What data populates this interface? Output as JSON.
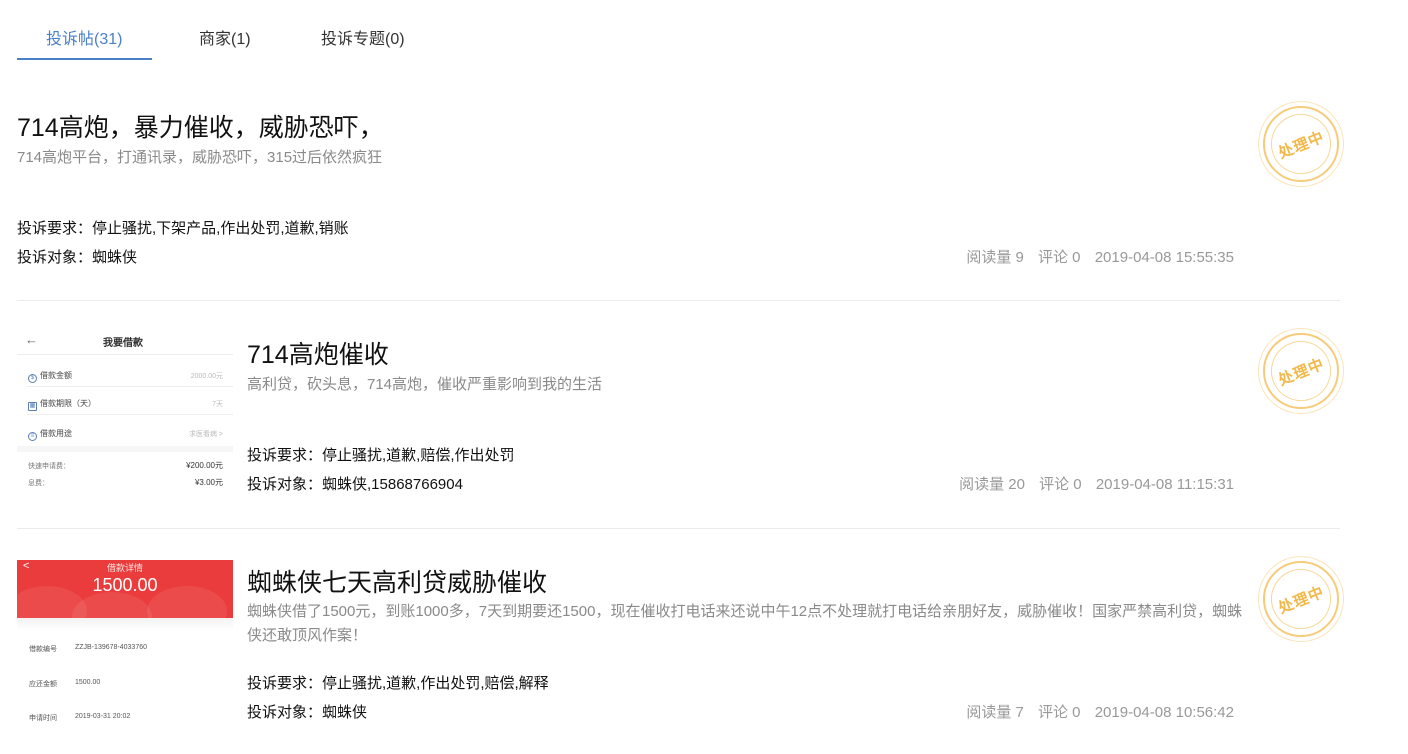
{
  "tabs": [
    {
      "label": "投诉帖(31)",
      "active": true
    },
    {
      "label": "商家(1)",
      "active": false
    },
    {
      "label": "投诉专题(0)",
      "active": false
    }
  ],
  "colors": {
    "accent": "#4a80c8",
    "stamp": "#f2b84a"
  },
  "posts": [
    {
      "title": "714高炮，暴力催收，威胁恐吓，",
      "summary": "714高炮平台，打通讯录，威胁恐吓，315过后依然疯狂",
      "requirement": "投诉要求：停止骚扰,下架产品,作出处罚,道歉,销账",
      "target": "投诉对象：蜘蛛侠",
      "reads": "阅读量 9",
      "comments": "评论 0",
      "time": "2019-04-08 15:55:35",
      "status": "处理中"
    },
    {
      "title": "714高炮催收",
      "summary": "高利贷，砍头息，714高炮，催收严重影响到我的生活",
      "requirement": "投诉要求：停止骚扰,道歉,赔偿,作出处罚",
      "target": "投诉对象：蜘蛛侠,15868766904",
      "reads": "阅读量 20",
      "comments": "评论 0",
      "time": "2019-04-08 11:15:31",
      "status": "处理中",
      "thumb": {
        "back": "←",
        "title": "我要借款",
        "rows": [
          {
            "icon": "$",
            "label": "借款金额",
            "value": "2000.00元"
          },
          {
            "icon": "▦",
            "label": "借款期限（天）",
            "value": "7天"
          },
          {
            "icon": "≡",
            "label": "借款用途",
            "value": "求医看病 >"
          }
        ],
        "fees": [
          {
            "label": "快速申请费：",
            "value": "¥200.00元"
          },
          {
            "label": "息费：",
            "value": "¥3.00元"
          }
        ]
      }
    },
    {
      "title": "蜘蛛侠七天高利贷威胁催收",
      "summary": "蜘蛛侠借了1500元，到账1000多，7天到期要还1500，现在催收打电话来还说中午12点不处理就打电话给亲朋好友，威胁催收！国家严禁高利贷，蜘蛛侠还敢顶风作案！",
      "requirement": "投诉要求：停止骚扰,道歉,作出处罚,赔偿,解释",
      "target": "投诉对象：蜘蛛侠",
      "reads": "阅读量 7",
      "comments": "评论 0",
      "time": "2019-04-08 10:56:42",
      "status": "处理中",
      "thumb": {
        "back": "<",
        "head": "借款详情",
        "amount": "1500.00",
        "rows": [
          {
            "label": "借款编号",
            "value": "ZZJB-139678-4033760"
          },
          {
            "label": "应还金额",
            "value": "1500.00"
          },
          {
            "label": "申请时间",
            "value": "2019-03-31 20:02"
          }
        ]
      }
    }
  ]
}
